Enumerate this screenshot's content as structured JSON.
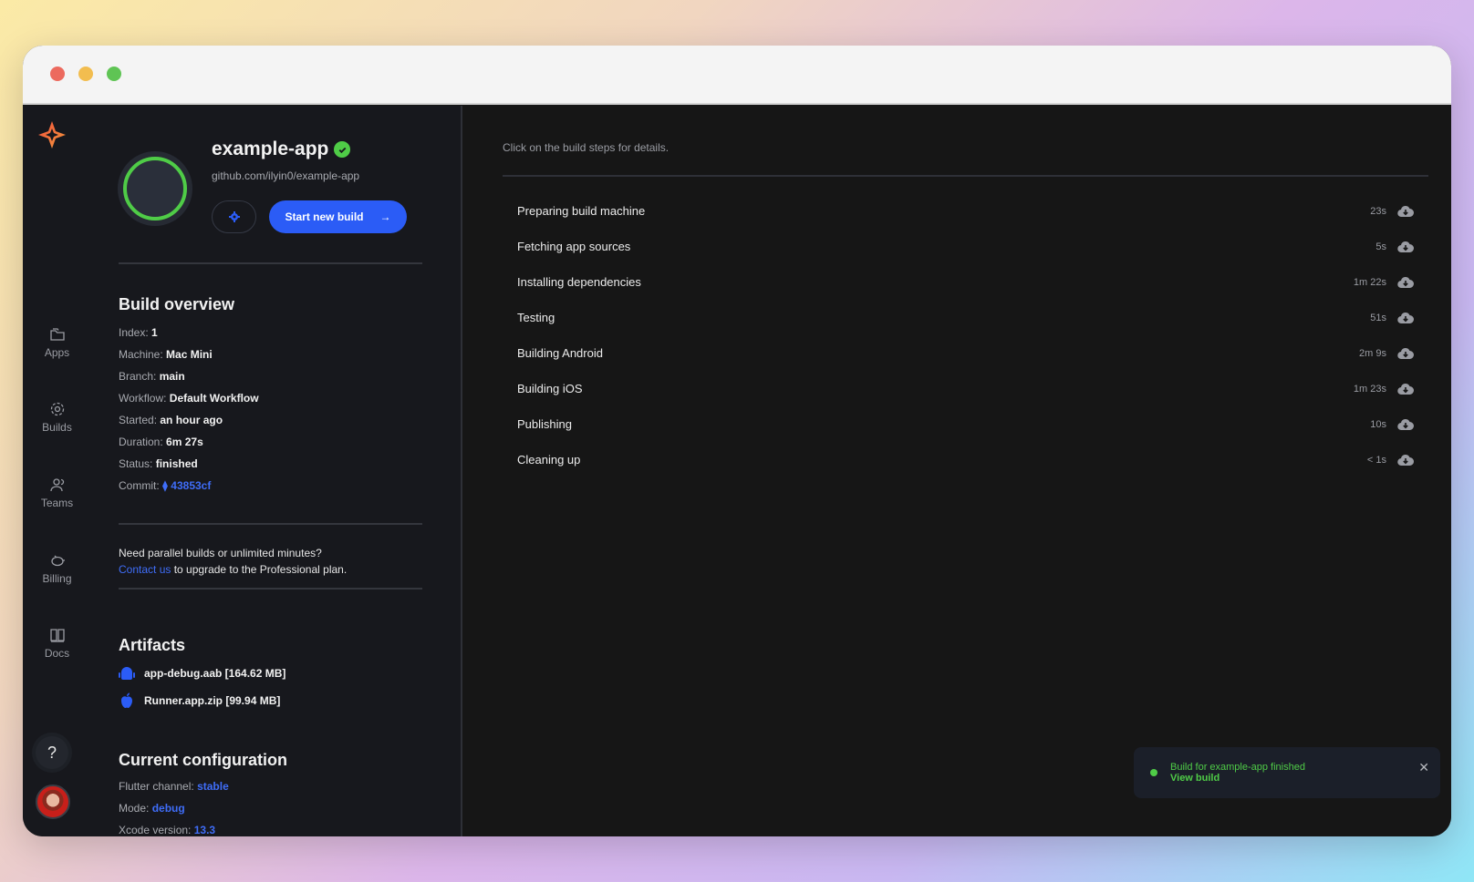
{
  "window": {
    "controls": [
      "close",
      "minimize",
      "maximize"
    ]
  },
  "nav": {
    "logo": "app-logo",
    "items": [
      {
        "label": "Apps",
        "icon": "folder-icon"
      },
      {
        "label": "Builds",
        "icon": "builds-icon"
      },
      {
        "label": "Teams",
        "icon": "users-icon"
      },
      {
        "label": "Billing",
        "icon": "piggy-bank-icon"
      },
      {
        "label": "Docs",
        "icon": "book-icon"
      }
    ],
    "help_label": "?"
  },
  "app": {
    "name": "example-app",
    "repo_url": "github.com/ilyin0/example-app",
    "start_build_label": "Start new build",
    "start_build_arrow": "→",
    "status_color": "#4fcc47",
    "accent_color": "#2b5cf6"
  },
  "overview": {
    "title": "Build overview",
    "fields": [
      {
        "label": "Index:",
        "value": "1"
      },
      {
        "label": "Machine:",
        "value": "Mac Mini"
      },
      {
        "label": "Branch:",
        "value": "main"
      },
      {
        "label": "Workflow:",
        "value": "Default Workflow"
      },
      {
        "label": "Started:",
        "value": "an hour ago"
      },
      {
        "label": "Duration:",
        "value": "6m 27s"
      },
      {
        "label": "Status:",
        "value": "finished"
      }
    ],
    "commit_label": "Commit:",
    "commit_value": "43853cf"
  },
  "upsell": {
    "line1": "Need parallel builds or unlimited minutes?",
    "link": "Contact us",
    "line2": " to upgrade to the Professional plan."
  },
  "artifacts": {
    "title": "Artifacts",
    "items": [
      {
        "name": "app-debug.aab [164.62 MB]",
        "icon": "android-icon"
      },
      {
        "name": "Runner.app.zip [99.94 MB]",
        "icon": "apple-icon"
      }
    ]
  },
  "config": {
    "title": "Current configuration",
    "fields": [
      {
        "label": "Flutter channel:",
        "value": "stable"
      },
      {
        "label": "Mode:",
        "value": "debug"
      },
      {
        "label": "Xcode version:",
        "value": "13.3"
      }
    ]
  },
  "steps": {
    "hint": "Click on the build steps for details.",
    "items": [
      {
        "name": "Preparing build machine",
        "duration": "23s"
      },
      {
        "name": "Fetching app sources",
        "duration": "5s"
      },
      {
        "name": "Installing dependencies",
        "duration": "1m 22s"
      },
      {
        "name": "Testing",
        "duration": "51s"
      },
      {
        "name": "Building Android",
        "duration": "2m 9s"
      },
      {
        "name": "Building iOS",
        "duration": "1m 23s"
      },
      {
        "name": "Publishing",
        "duration": "10s"
      },
      {
        "name": "Cleaning up",
        "duration": "< 1s"
      }
    ]
  },
  "toast": {
    "message": "Build for example-app finished",
    "action": "View build",
    "close": "✕"
  }
}
